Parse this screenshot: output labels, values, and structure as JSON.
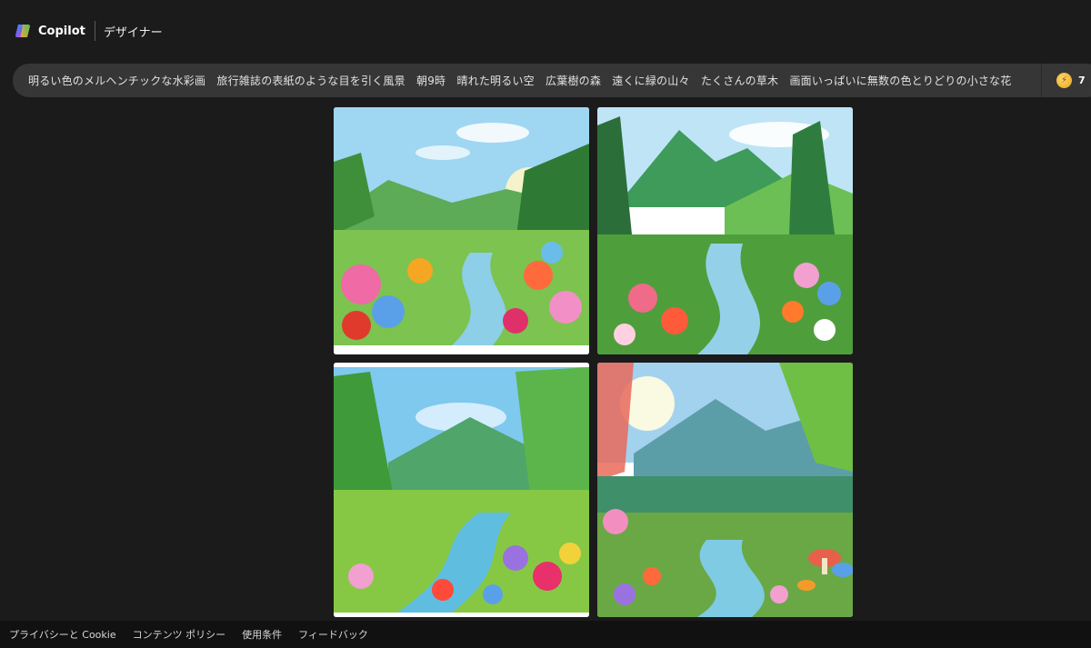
{
  "header": {
    "brand": "Copilot",
    "subtitle": "デザイナー"
  },
  "prompt": {
    "text": "明るい色のメルヘンチックな水彩画　旅行雑誌の表紙のような目を引く風景　朝9時　晴れた明るい空　広葉樹の森　遠くに緑の山々　たくさんの草木　画面いっぱいに無数の色とりどりの小さな花",
    "boost_count": "7"
  },
  "images": [
    {
      "name": "forest-meadow-stream",
      "colors": {
        "sky": "#9fd6f2",
        "hill": "#5dab57",
        "ground": "#7cc34f",
        "water": "#8ccfe6"
      }
    },
    {
      "name": "mountain-valley-stream",
      "colors": {
        "sky": "#bfe4f6",
        "hill": "#3e9b5a",
        "ground": "#4f9e3c",
        "water": "#94d1e8"
      }
    },
    {
      "name": "green-hills-wildflowers",
      "colors": {
        "sky": "#7fc8ee",
        "hill": "#4fa56a",
        "ground": "#86c844",
        "water": "#5fbde0"
      }
    },
    {
      "name": "sunlit-mountains-mushrooms",
      "colors": {
        "sky": "#a3d2ef",
        "hill": "#5b9ea8",
        "ground": "#6aa845",
        "water": "#7fcbe3"
      }
    }
  ],
  "footer": {
    "links": [
      "プライバシーと Cookie",
      "コンテンツ ポリシー",
      "使用条件",
      "フィードバック"
    ]
  }
}
